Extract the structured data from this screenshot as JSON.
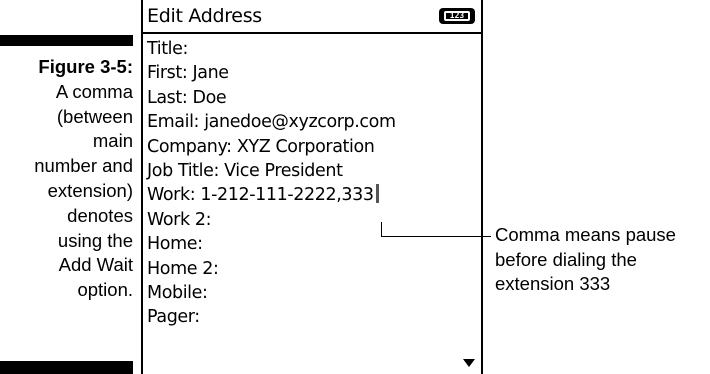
{
  "caption": {
    "figure": "Figure 3-5:",
    "lines": [
      "A comma",
      "(between",
      "main",
      "number and",
      "extension)",
      "denotes",
      "using the",
      "Add Wait",
      "option."
    ]
  },
  "window": {
    "title": "Edit Address",
    "badge": "123"
  },
  "fields": [
    "Title:",
    "First: Jane",
    "Last: Doe",
    "Email: janedoe@xyzcorp.com",
    "Company: XYZ Corporation",
    "Job Title: Vice President",
    "Work: 1-212-111-2222,333",
    "Work 2:",
    "Home:",
    "Home 2:",
    "Mobile:",
    "Pager:"
  ],
  "callout": {
    "lines": [
      "Comma means pause",
      "before dialing the",
      "extension 333"
    ]
  }
}
